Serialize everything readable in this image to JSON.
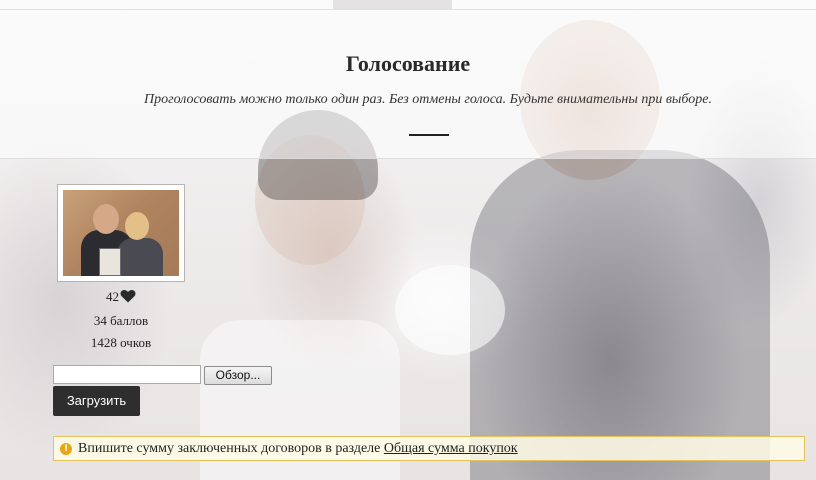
{
  "header": {
    "title": "Голосование",
    "subtitle": "Проголосовать можно только один раз. Без отмены голоса. Будьте внимательны при выборе."
  },
  "entry": {
    "likes": "42",
    "points": "34 баллов",
    "scores": "1428 очков",
    "icon": "heart-icon"
  },
  "upload": {
    "browse_label": "Обзор...",
    "upload_label": "Загрузить",
    "file_value": ""
  },
  "notice": {
    "text": "Впишите сумму заключенных договоров в разделе ",
    "link_text": "Общая сумма покупок",
    "icon": "info-icon",
    "accent_color": "#e6a817"
  }
}
